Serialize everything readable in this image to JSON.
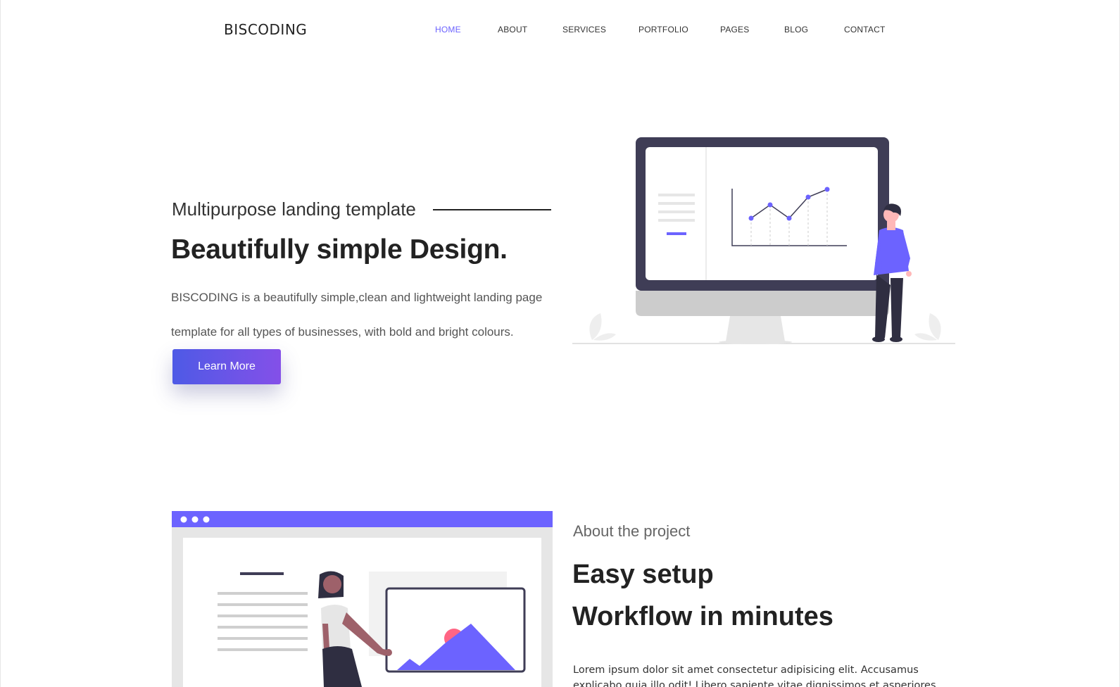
{
  "nav": {
    "brand": "BISCODING",
    "items": [
      {
        "label": "HOME",
        "active": true
      },
      {
        "label": "ABOUT",
        "active": false
      },
      {
        "label": "SERVICES",
        "active": false
      },
      {
        "label": "PORTFOLIO",
        "active": false
      },
      {
        "label": "PAGES",
        "active": false
      },
      {
        "label": "BLOG",
        "active": false
      },
      {
        "label": "CONTACT",
        "active": false
      }
    ]
  },
  "hero": {
    "subtitle": "Multipurpose landing template",
    "title": "Beautifully simple Design.",
    "description": "BISCODING is a beautifully simple,clean and lightweight landing page template for all types of businesses, with bold and bright colours.",
    "cta_label": "Learn More",
    "illustration": "analytics-monitor-person-illustration"
  },
  "about": {
    "eyebrow": "About the project",
    "title_line1": "Easy setup",
    "title_line2": "Workflow in minutes",
    "text": "Lorem ipsum dolor sit amet consectetur adipisicing elit. Accusamus explicabo quia illo odit! Libero sapiente vitae dignissimos et asperiores",
    "illustration": "browser-window-woman-image-illustration"
  },
  "colors": {
    "accent": "#6c63ff",
    "button_gradient_start": "#4e5ae6",
    "button_gradient_end": "#8450e8",
    "dark": "#3f3d56"
  }
}
